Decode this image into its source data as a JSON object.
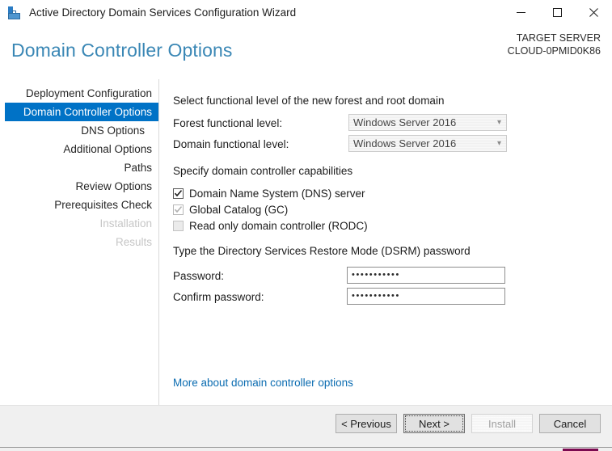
{
  "window": {
    "title": "Active Directory Domain Services Configuration Wizard",
    "icon": "ad-server-icon",
    "controls": {
      "minimize": "minimize-icon",
      "maximize": "maximize-icon",
      "close": "close-icon"
    }
  },
  "header": {
    "page_title": "Domain Controller Options",
    "target_server_label": "TARGET SERVER",
    "target_server_name": "CLOUD-0PMID0K86"
  },
  "nav": {
    "items": [
      {
        "label": "Deployment Configuration",
        "selected": false,
        "disabled": false,
        "indent": false
      },
      {
        "label": "Domain Controller Options",
        "selected": true,
        "disabled": false,
        "indent": false
      },
      {
        "label": "DNS Options",
        "selected": false,
        "disabled": false,
        "indent": true
      },
      {
        "label": "Additional Options",
        "selected": false,
        "disabled": false,
        "indent": false
      },
      {
        "label": "Paths",
        "selected": false,
        "disabled": false,
        "indent": false
      },
      {
        "label": "Review Options",
        "selected": false,
        "disabled": false,
        "indent": false
      },
      {
        "label": "Prerequisites Check",
        "selected": false,
        "disabled": false,
        "indent": false
      },
      {
        "label": "Installation",
        "selected": false,
        "disabled": true,
        "indent": false
      },
      {
        "label": "Results",
        "selected": false,
        "disabled": true,
        "indent": false
      }
    ]
  },
  "main": {
    "functional_level": {
      "heading": "Select functional level of the new forest and root domain",
      "forest_label": "Forest functional level:",
      "forest_value": "Windows Server 2016",
      "domain_label": "Domain functional level:",
      "domain_value": "Windows Server 2016",
      "arrow_icon": "chevron-down-icon"
    },
    "capabilities": {
      "heading": "Specify domain controller capabilities",
      "items": [
        {
          "label": "Domain Name System (DNS) server",
          "checked": true,
          "disabled": false
        },
        {
          "label": "Global Catalog (GC)",
          "checked": true,
          "disabled": true
        },
        {
          "label": "Read only domain controller (RODC)",
          "checked": false,
          "disabled": true
        }
      ]
    },
    "dsrm": {
      "heading": "Type the Directory Services Restore Mode (DSRM) password",
      "password_label": "Password:",
      "password_value": "•••••••••••",
      "confirm_label": "Confirm password:",
      "confirm_value": "•••••••••••"
    },
    "more_link": "More about domain controller options"
  },
  "footer": {
    "buttons": [
      {
        "label": "< Previous",
        "state": "normal"
      },
      {
        "label": "Next >",
        "state": "focused"
      },
      {
        "label": "Install",
        "state": "disabled"
      },
      {
        "label": "Cancel",
        "state": "normal"
      }
    ]
  },
  "colors": {
    "accent_blue": "#0072c6",
    "title_blue": "#3a87b5",
    "link_blue": "#0b6cb1",
    "strip_magenta": "#7b0a50"
  }
}
